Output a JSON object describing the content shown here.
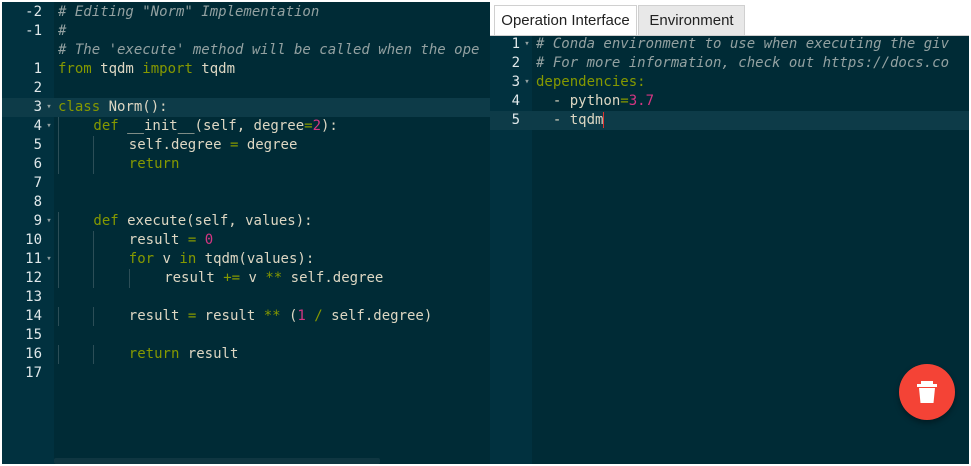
{
  "left_editor": {
    "lines": [
      {
        "num": "-2",
        "fold": "",
        "tokens": [
          {
            "t": "# Editing \"Norm\" Implementation",
            "c": "cm"
          }
        ]
      },
      {
        "num": "-1",
        "fold": "",
        "tokens": [
          {
            "t": "#",
            "c": "cm"
          }
        ]
      },
      {
        "num": "",
        "fold": "",
        "tokens": [
          {
            "t": "# The 'execute' method will be called when the ope",
            "c": "cm"
          }
        ]
      },
      {
        "num": "1",
        "fold": "",
        "tokens": [
          {
            "t": "from",
            "c": "kw"
          },
          {
            "t": " tqdm ",
            "c": "tx"
          },
          {
            "t": "import",
            "c": "kw"
          },
          {
            "t": " tqdm",
            "c": "tx"
          }
        ]
      },
      {
        "num": "2",
        "fold": "",
        "tokens": []
      },
      {
        "num": "3",
        "fold": "▾",
        "active": true,
        "tokens": [
          {
            "t": "class",
            "c": "kw"
          },
          {
            "t": " Norm():",
            "c": "tx"
          }
        ]
      },
      {
        "num": "4",
        "fold": "▾",
        "indent": 1,
        "tokens": [
          {
            "t": "def",
            "c": "kw"
          },
          {
            "t": " __init__(self, degree",
            "c": "tx"
          },
          {
            "t": "=",
            "c": "op"
          },
          {
            "t": "2",
            "c": "nm"
          },
          {
            "t": "):",
            "c": "tx"
          }
        ]
      },
      {
        "num": "5",
        "fold": "",
        "indent": 2,
        "tokens": [
          {
            "t": "self.degree ",
            "c": "tx"
          },
          {
            "t": "=",
            "c": "op"
          },
          {
            "t": " degree",
            "c": "tx"
          }
        ]
      },
      {
        "num": "6",
        "fold": "",
        "indent": 2,
        "tokens": [
          {
            "t": "return",
            "c": "kw"
          }
        ]
      },
      {
        "num": "7",
        "fold": "",
        "tokens": []
      },
      {
        "num": "8",
        "fold": "",
        "tokens": []
      },
      {
        "num": "9",
        "fold": "▾",
        "indent": 1,
        "tokens": [
          {
            "t": "def",
            "c": "kw"
          },
          {
            "t": " execute(self, values):",
            "c": "tx"
          }
        ]
      },
      {
        "num": "10",
        "fold": "",
        "indent": 2,
        "tokens": [
          {
            "t": "result ",
            "c": "tx"
          },
          {
            "t": "=",
            "c": "op"
          },
          {
            "t": " ",
            "c": "tx"
          },
          {
            "t": "0",
            "c": "nm"
          }
        ]
      },
      {
        "num": "11",
        "fold": "▾",
        "indent": 2,
        "tokens": [
          {
            "t": "for",
            "c": "kw"
          },
          {
            "t": " v ",
            "c": "tx"
          },
          {
            "t": "in",
            "c": "kw"
          },
          {
            "t": " tqdm(values):",
            "c": "tx"
          }
        ]
      },
      {
        "num": "12",
        "fold": "",
        "indent": 3,
        "tokens": [
          {
            "t": "result ",
            "c": "tx"
          },
          {
            "t": "+=",
            "c": "op"
          },
          {
            "t": " v ",
            "c": "tx"
          },
          {
            "t": "**",
            "c": "op"
          },
          {
            "t": " self.degree",
            "c": "tx"
          }
        ]
      },
      {
        "num": "13",
        "fold": "",
        "tokens": []
      },
      {
        "num": "14",
        "fold": "",
        "indent": 2,
        "tokens": [
          {
            "t": "result ",
            "c": "tx"
          },
          {
            "t": "=",
            "c": "op"
          },
          {
            "t": " result ",
            "c": "tx"
          },
          {
            "t": "**",
            "c": "op"
          },
          {
            "t": " (",
            "c": "tx"
          },
          {
            "t": "1",
            "c": "nm"
          },
          {
            "t": " ",
            "c": "tx"
          },
          {
            "t": "/",
            "c": "op"
          },
          {
            "t": " self.degree)",
            "c": "tx"
          }
        ]
      },
      {
        "num": "15",
        "fold": "",
        "tokens": []
      },
      {
        "num": "16",
        "fold": "",
        "indent": 2,
        "tokens": [
          {
            "t": "return",
            "c": "kw"
          },
          {
            "t": " result",
            "c": "tx"
          }
        ]
      },
      {
        "num": "17",
        "fold": "",
        "tokens": []
      }
    ]
  },
  "tabs": [
    {
      "label": "Operation Interface",
      "active": true
    },
    {
      "label": "Environment",
      "active": false
    }
  ],
  "right_editor": {
    "lines": [
      {
        "num": "1",
        "fold": "▾",
        "tokens": [
          {
            "t": "# Conda environment to use when executing the giv",
            "c": "cm"
          }
        ]
      },
      {
        "num": "2",
        "fold": "",
        "tokens": [
          {
            "t": "# For more information, check out https://docs.co",
            "c": "cm"
          }
        ]
      },
      {
        "num": "3",
        "fold": "▾",
        "tokens": [
          {
            "t": "dependencies:",
            "c": "ky"
          }
        ]
      },
      {
        "num": "4",
        "fold": "",
        "tokens": [
          {
            "t": "  - python",
            "c": "tx"
          },
          {
            "t": "=",
            "c": "op"
          },
          {
            "t": "3.7",
            "c": "nm"
          }
        ]
      },
      {
        "num": "5",
        "fold": "",
        "active": true,
        "cursor": true,
        "tokens": [
          {
            "t": "  - tqdm",
            "c": "tx"
          }
        ]
      }
    ]
  },
  "icons": {
    "delete": "trash-icon",
    "fold": "fold-arrow-icon"
  },
  "colors": {
    "editor_bg": "#002b36",
    "delete_button": "#f44336"
  }
}
